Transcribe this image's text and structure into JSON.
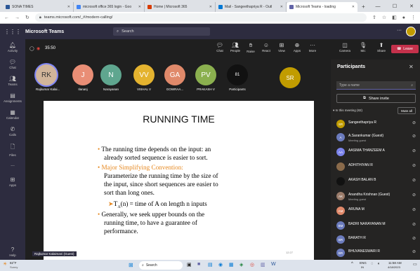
{
  "browser": {
    "tabs": [
      {
        "title": "SONA TIMES",
        "fav": "#2b5797",
        "active": false
      },
      {
        "title": "microsoft office 365 login - Goo",
        "fav": "#4285f4",
        "active": false
      },
      {
        "title": "Home | Microsoft 365",
        "fav": "#d83b01",
        "active": false
      },
      {
        "title": "Mail - Sangeethapriya R - Outl",
        "fav": "#0078d4",
        "active": false
      },
      {
        "title": "Microsoft Teams - loading",
        "fav": "#6264a7",
        "active": true
      }
    ],
    "url": "teams.microsoft.com/_#/modern-calling/"
  },
  "teams": {
    "brand": "Microsoft Teams",
    "search_placeholder": "Search",
    "rail": [
      "Activity",
      "Chat",
      "Teams",
      "Assignments",
      "Calendar",
      "Calls",
      "Files",
      "...",
      "Apps",
      "Help"
    ]
  },
  "meeting": {
    "timer": "35:50",
    "controls": [
      "Chat",
      "People",
      "Raise",
      "React",
      "View",
      "Apps",
      "More",
      "Camera",
      "Mic",
      "Share"
    ],
    "leave_label": "Leave",
    "tiles": [
      {
        "initials": "RK",
        "name": "Rajkumar Kalai...",
        "color": "#d1b59a",
        "textcolor": "#333"
      },
      {
        "initials": "J",
        "name": "Ilananj",
        "color": "#e98e76"
      },
      {
        "initials": "N",
        "name": "Narayanan",
        "color": "#5fa68f"
      },
      {
        "initials": "VV",
        "name": "VISHAL V",
        "color": "#e4b32f"
      },
      {
        "initials": "GA",
        "name": "GOWRAA...",
        "color": "#e0896a"
      },
      {
        "initials": "PV",
        "name": "PRAKASH V",
        "color": "#8bb04f"
      },
      {
        "initials": "81",
        "name": "Participants",
        "color": "#111111"
      }
    ],
    "self_tile": "SR",
    "presenter_badge": "Rajkumar Kalaimani (Guest)"
  },
  "slide": {
    "title": "RUNNING TIME",
    "b1a": "The running time depends on the input: an",
    "b1b": "already sorted sequence is easier to sort.",
    "b2": "Major Simplifying Convention:",
    "b2a": "Parameterize the running time by the size of",
    "b2b": "the input, since short sequences are easier to",
    "b2c": "sort than long ones.",
    "b3_arrow": "➤",
    "b3_t": "T",
    "b3_sub": "A",
    "b3_rest": "(n) =  time of A on length n inputs",
    "b4a": "Generally, we seek upper bounds on the",
    "b4b": "running time, to have a guarantee of",
    "b4c": "performance.",
    "page": "12:27"
  },
  "participants": {
    "title": "Participants",
    "type_placeholder": "Type a name",
    "invite": "Share invite",
    "in_meeting": "In this meeting (82)",
    "mute_all": "Mute all",
    "list": [
      {
        "initials": "SR",
        "name": "Sangeethapriya R",
        "sub": "",
        "color": "#c19c00"
      },
      {
        "initials": "A",
        "name": "A.Sarankumar (Guest)",
        "sub": "Meeting guest",
        "color": "#6b7bbd"
      },
      {
        "initials": "AA",
        "name": "AASIMA THANZEEM A",
        "sub": "",
        "color": "#7b83eb"
      },
      {
        "initials": "",
        "name": "ADHITHIYAN R",
        "sub": "",
        "color": "#8a6a4a"
      },
      {
        "initials": "",
        "name": "AKASH BALAN B",
        "sub": "",
        "color": "#111111"
      },
      {
        "initials": "AK",
        "name": "Anandha Krishnan (Guest)",
        "sub": "Meeting guest",
        "color": "#9a7b6a"
      },
      {
        "initials": "AM",
        "name": "ARUNA M",
        "sub": "",
        "color": "#e0896a"
      },
      {
        "initials": "BM",
        "name": "BADRI NARAYANAN M",
        "sub": "",
        "color": "#6b7bbd"
      },
      {
        "initials": "BR",
        "name": "BARATH R",
        "sub": "",
        "color": "#6b7bbd"
      },
      {
        "initials": "BR",
        "name": "BHUVANESWARI R",
        "sub": "",
        "color": "#6b7bbd"
      }
    ]
  },
  "taskbar": {
    "weather": "82°F",
    "weather_sub": "Sunny",
    "search": "Search",
    "lang": "ENG",
    "lang_sub": "IN",
    "time": "11:58 AM",
    "date": "4/18/2023"
  }
}
